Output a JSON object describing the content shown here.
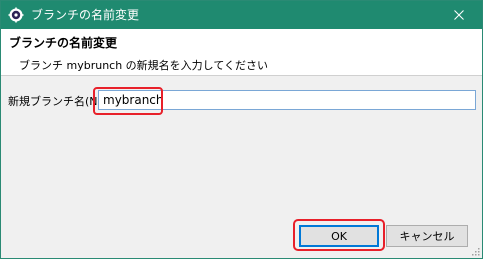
{
  "window": {
    "title": "ブランチの名前変更"
  },
  "header": {
    "title": "ブランチの名前変更",
    "message": "ブランチ mybrunch の新規名を入力してください"
  },
  "form": {
    "label": "新規ブランチ名(N):",
    "value": "mybranch"
  },
  "buttons": {
    "ok": "OK",
    "cancel": "キャンセル"
  },
  "colors": {
    "titlebar": "#1f8a70",
    "highlight": "#e8202a",
    "focus_border": "#0078d7"
  },
  "icons": {
    "app": "eclipse-gear-icon",
    "close": "close-icon",
    "resize": "resize-gripper-icon"
  }
}
